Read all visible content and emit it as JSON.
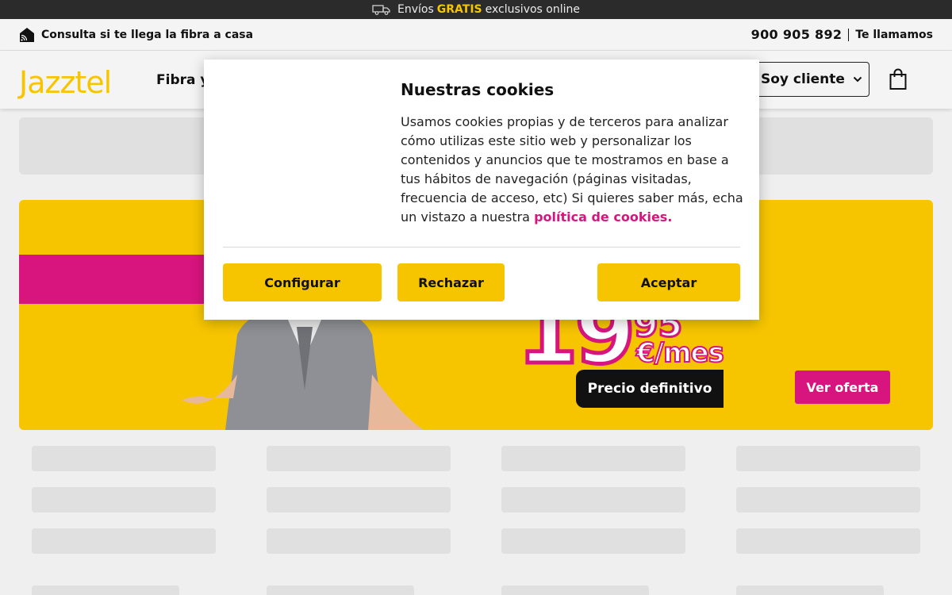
{
  "promo": {
    "prefix": "Envíos",
    "highlight": "GRATIS",
    "suffix": "exclusivos online",
    "icon": "truck-icon"
  },
  "subbar": {
    "coverage_label": "Consulta si te llega la fibra a casa",
    "phone": "900 905 892",
    "callback_label": "Te llamamos"
  },
  "header": {
    "logo": "Jazztel",
    "nav_item": "Fibra y",
    "client_button": "Soy cliente"
  },
  "banner": {
    "price": "19",
    "cents": "95",
    "per_month": "€/mes",
    "badge": "Precio definitivo",
    "cta": "Ver oferta"
  },
  "cookies": {
    "title": "Nuestras cookies",
    "body": "Usamos cookies propias y de terceros para analizar cómo utilizas este sitio web y personalizar los contenidos y anuncios que te mostramos en base a tus hábitos de navegación (páginas visitadas, frecuencia de acceso, etc) Si quieres saber más, echa un vistazo a nuestra",
    "link": "política de cookies.",
    "configure": "Configurar",
    "reject": "Rechazar",
    "accept": "Aceptar"
  },
  "colors": {
    "brand_yellow": "#f7c500",
    "brand_magenta": "#d8157f",
    "dark": "#2b2b2b"
  }
}
